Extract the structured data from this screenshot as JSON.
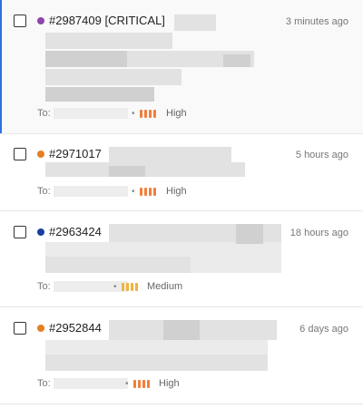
{
  "colors": {
    "accent": "#2f6fe0",
    "critical_dot": "#8e44ad",
    "high_dot": "#e67e22",
    "low_dot": "#1a3fa0",
    "priority_high": "#f07f3c",
    "priority_medium": "#f0b43c",
    "bar_inactive": "#d8d8d8"
  },
  "tickets": [
    {
      "id": "#2987409 [CRITICAL]",
      "time": "3 minutes ago",
      "to_label": "To:",
      "separator": "•",
      "priority": "High",
      "priority_level": 3,
      "dot_icon": "status-dot-purple"
    },
    {
      "id": "#2971017",
      "time": "5 hours ago",
      "to_label": "To:",
      "separator": "•",
      "priority": "High",
      "priority_level": 3,
      "dot_icon": "status-dot-orange"
    },
    {
      "id": "#2963424",
      "time": "18 hours ago",
      "to_label": "To:",
      "separator": "•",
      "priority": "Medium",
      "priority_level": 2,
      "dot_icon": "status-dot-blue"
    },
    {
      "id": "#2952844",
      "time": "6 days ago",
      "to_label": "To:",
      "separator": "•",
      "priority": "High",
      "priority_level": 3,
      "dot_icon": "status-dot-orange"
    }
  ]
}
